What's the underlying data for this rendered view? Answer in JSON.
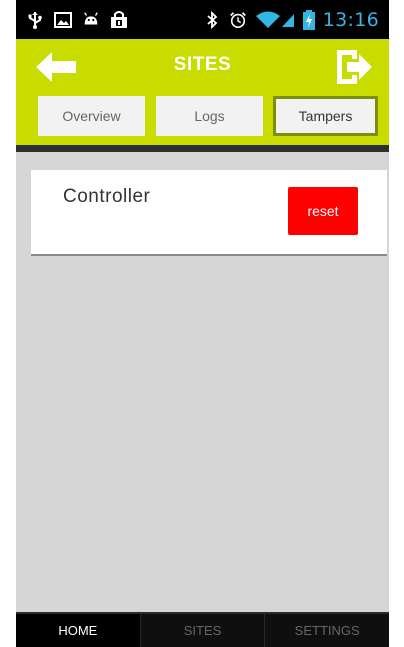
{
  "status_bar": {
    "icons_left": [
      "usb-icon",
      "image-icon",
      "android-icon",
      "shopping-bag-icon"
    ],
    "icons_right": [
      "bluetooth-icon",
      "alarm-icon",
      "wifi-icon",
      "signal-icon",
      "battery-icon"
    ],
    "time": "13:16",
    "time_color": "#33b5e5"
  },
  "header": {
    "title": "SITES",
    "background_color": "#c8dc00",
    "back_icon": "arrow-left-icon",
    "logout_icon": "logout-icon"
  },
  "tabs": [
    {
      "label": "Overview",
      "selected": false
    },
    {
      "label": "Logs",
      "selected": false
    },
    {
      "label": "Tampers",
      "selected": true
    }
  ],
  "content": {
    "card": {
      "title": "Controller",
      "action_label": "reset",
      "action_color": "#ff0000"
    }
  },
  "bottom_nav": {
    "items": [
      {
        "label": "HOME",
        "active": true
      },
      {
        "label": "SITES",
        "active": false
      },
      {
        "label": "SETTINGS",
        "active": false
      }
    ]
  }
}
